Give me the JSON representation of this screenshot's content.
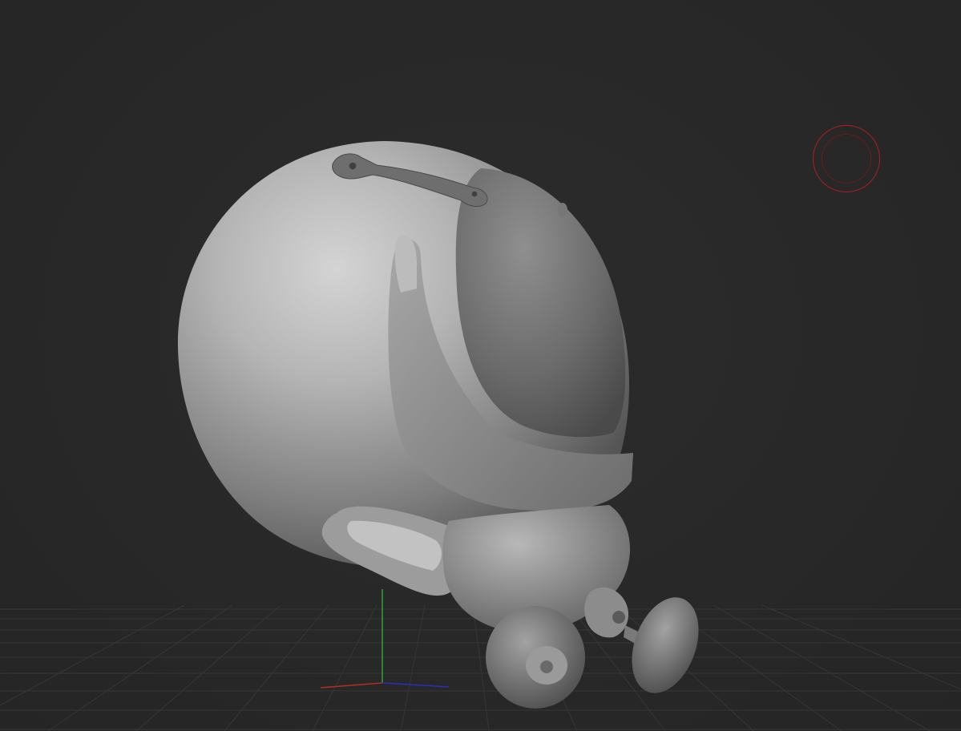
{
  "app": {
    "title": ""
  },
  "viewport": {
    "background_color": "#282828",
    "model": {
      "name": "",
      "kind": "helmet-sculpt"
    },
    "floor_grid": {
      "visible": true,
      "color": "#3a3a3a"
    },
    "axes": {
      "x_color": "#b03020",
      "y_color": "#2ea33a",
      "z_color": "#2a2ec0"
    },
    "brush_cursor": {
      "color": "#b01e1e"
    }
  }
}
